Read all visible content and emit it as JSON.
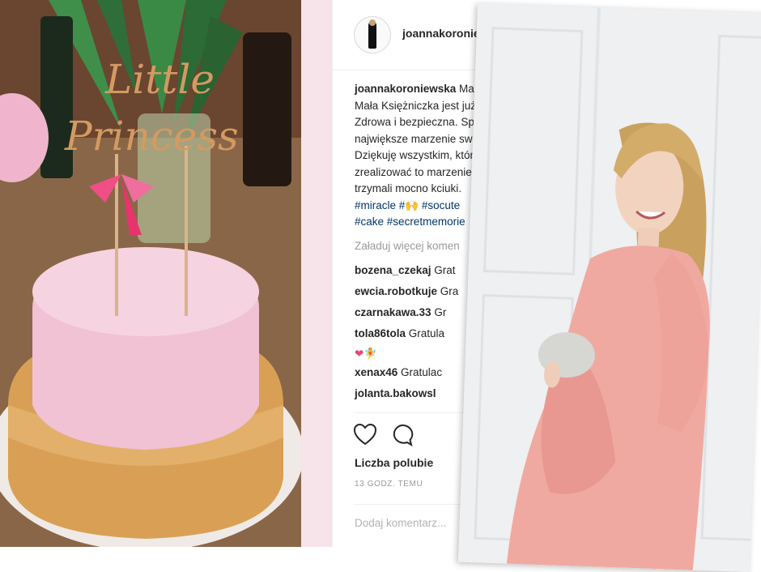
{
  "cake_photo": {
    "topper_text": "Little Princess"
  },
  "post": {
    "username": "joannakoroniewska",
    "caption_lines": [
      {
        "user": "joannakoroniewska",
        "text": " Marze"
      },
      {
        "text": "Mała Księżniczka jest już ."
      },
      {
        "text": "Zdrowa i bezpieczna. Spe"
      },
      {
        "text": "największe marzenie swo"
      },
      {
        "text": "Dziękuję wszystkim, któr"
      },
      {
        "text": "zrealizować to marzenie"
      },
      {
        "text": "trzymali mocno kciuki. "
      }
    ],
    "hashtags_line1": [
      "#miracle",
      "#🙌",
      "#socute"
    ],
    "hashtags_line2": [
      "#cake",
      "#secretmemorie"
    ],
    "load_more": "Załaduj więcej komen",
    "comments": [
      {
        "user": "bozena_czekaj",
        "text": " Grat"
      },
      {
        "user": "ewcia.robotkuje",
        "text": " Gra"
      },
      {
        "user": "czarnakawa.33",
        "text": " Gr"
      },
      {
        "user": "tola86tola",
        "text": " Gratula"
      },
      {
        "user": "",
        "text": "❤🧚"
      },
      {
        "user": "xenax46",
        "text": " Gratulac"
      },
      {
        "user": "jolanta.bakowsl",
        "text": ""
      }
    ],
    "likes_label": "Liczba polubie",
    "timestamp": "13 GODZ. TEMU",
    "add_comment_placeholder": "Dodaj komentarz..."
  },
  "icons": {
    "like": "heart-outline-icon",
    "comment": "comment-bubble-icon"
  },
  "colors": {
    "hashtag": "#003569",
    "text": "#262626",
    "muted": "#999999",
    "accent_pink": "#f7e3ea"
  }
}
